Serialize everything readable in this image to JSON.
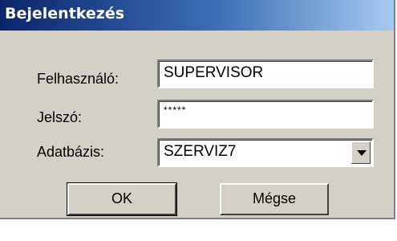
{
  "window": {
    "title": "Bejelentkezés"
  },
  "form": {
    "user_label": "Felhasználó:",
    "user_value": "SUPERVISOR",
    "password_label": "Jelszó:",
    "password_value": "*****",
    "database_label": "Adatbázis:",
    "database_value": "SZERVIZ7"
  },
  "buttons": {
    "ok_label": "OK",
    "cancel_label": "Mégse"
  },
  "icons": {
    "dropdown": "chevron-down-icon"
  },
  "colors": {
    "titlebar_start": "#0a246a",
    "titlebar_end": "#a6caf0",
    "face": "#d4d0c8"
  }
}
